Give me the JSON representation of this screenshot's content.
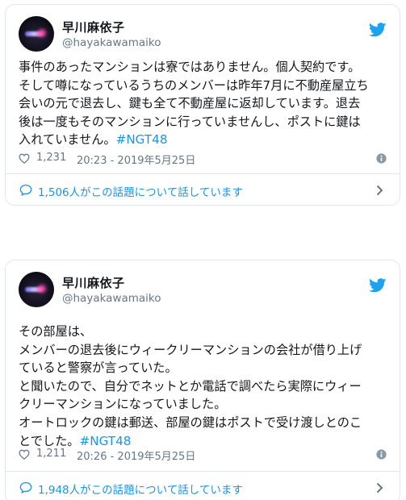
{
  "tweets": [
    {
      "display_name": "早川麻依子",
      "screen_name": "@hayakawamaiko",
      "text_lines": [
        "事件のあったマンションは寮ではありません。個人契約です。",
        "そして噂になっているうちのメンバーは昨年7月に不動産屋立ち",
        "会いの元で退去し、鍵も全て不動産屋に返却しています。退去",
        "後は一度もそのマンションに行っていませんし、ポストに鍵は",
        "入れていません。"
      ],
      "hashtag": "#NGT48",
      "likes": "1,231",
      "timestamp": "20:23 - 2019年5月25日",
      "conversation": "1,506人がこの話題について話しています"
    },
    {
      "display_name": "早川麻依子",
      "screen_name": "@hayakawamaiko",
      "text_lines": [
        "その部屋は、",
        "メンバーの退去後にウィークリーマンションの会社が借り上げ",
        "ていると警察が言っていた。",
        "と聞いたので、自分でネットとか電話で調べたら実際にウィー",
        "クリーマンションになっていました。",
        "オートロックの鍵は郵送、部屋の鍵はポストで受け渡しとのこ",
        "とでした。"
      ],
      "hashtag": "#NGT48",
      "likes": "1,211",
      "timestamp": "20:26 - 2019年5月25日",
      "conversation": "1,948人がこの話題について話しています"
    }
  ],
  "icons": {
    "brand": "twitter-bird-icon",
    "like": "heart-icon",
    "info": "info-icon",
    "conversation": "chat-bubble-icon",
    "more": "chevron-right-icon"
  },
  "colors": {
    "link": "#1b95e0",
    "text": "#14171a",
    "secondary": "#657786",
    "border": "#e1e8ed"
  }
}
